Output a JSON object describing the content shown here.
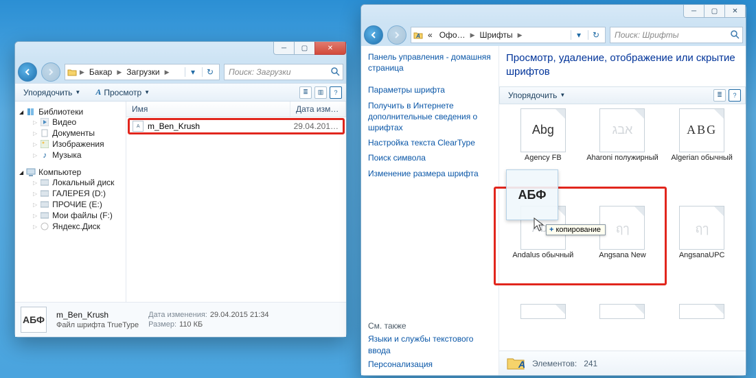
{
  "left_window": {
    "breadcrumb": {
      "root": "Бакар",
      "child": "Загрузки"
    },
    "search_placeholder": "Поиск: Загрузки",
    "toolbar": {
      "organize": "Упорядочить",
      "preview": "Просмотр"
    },
    "columns": {
      "name": "Имя",
      "date": "Дата изм…"
    },
    "file": {
      "name": "m_Ben_Krush",
      "date": "29.04.201…"
    },
    "nav": {
      "libraries": "Библиотеки",
      "video": "Видео",
      "documents": "Документы",
      "pictures": "Изображения",
      "music": "Музыка",
      "computer": "Компьютер",
      "drive_c": "Локальный диск",
      "drive_d": "ГАЛЕРЕЯ (D:)",
      "drive_e": "ПРОЧИЕ (E:)",
      "drive_f": "Мои файлы (F:)",
      "yadisk": "Яндекс.Диск"
    },
    "status": {
      "file_name": "m_Ben_Krush",
      "file_type": "Файл шрифта TrueType",
      "mod_label": "Дата изменения:",
      "mod_value": "29.04.2015 21:34",
      "size_label": "Размер:",
      "size_value": "110 КБ",
      "thumb_text": "АБФ"
    }
  },
  "right_window": {
    "breadcrumb": {
      "back": "«",
      "office": "Офо…",
      "fonts": "Шрифты"
    },
    "search_placeholder": "Поиск: Шрифты",
    "sidebar": {
      "home": "Панель управления - домашняя страница",
      "params": "Параметры шрифта",
      "online": "Получить в Интернете дополнительные сведения о шрифтах",
      "cleartype": "Настройка текста ClearType",
      "symbol": "Поиск символа",
      "resize": "Изменение размера шрифта",
      "also_head": "См. также",
      "also1": "Языки и службы текстового ввода",
      "also2": "Персонализация"
    },
    "title": "Просмотр, удаление, отображение или скрытие шрифтов",
    "toolbar": {
      "organize": "Упорядочить"
    },
    "fonts": [
      {
        "sample": "Abg",
        "label": "Agency FB"
      },
      {
        "sample": "אבג",
        "label": "Aharoni полужирный"
      },
      {
        "sample": "ABG",
        "label": "Algerian обычный"
      },
      {
        "sample": "Abg",
        "label": "Andalus обычный"
      },
      {
        "sample": "ฤๅ",
        "label": "Angsana New"
      },
      {
        "sample": "ฤๅ",
        "label": "AngsanaUPC"
      }
    ],
    "drag": {
      "thumb_text": "АБФ",
      "tooltip": "копирование"
    },
    "strip": {
      "count_label": "Элементов:",
      "count_value": "241"
    }
  }
}
